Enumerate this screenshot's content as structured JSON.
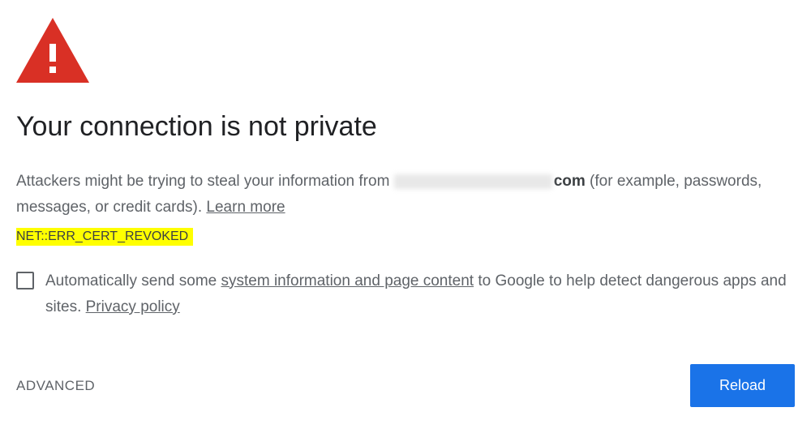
{
  "title": "Your connection is not private",
  "body": {
    "prefix": "Attackers might be trying to steal your information from ",
    "domain_suffix": "com",
    "suffix": " (for example, passwords, messages, or credit cards). ",
    "learn_more": "Learn more"
  },
  "error_code": "NET::ERR_CERT_REVOKED",
  "checkbox": {
    "prefix": "Automatically send some ",
    "link1": "system information and page content",
    "mid": " to Google to help detect dangerous apps and sites. ",
    "link2": "Privacy policy"
  },
  "buttons": {
    "advanced": "ADVANCED",
    "reload": "Reload"
  },
  "colors": {
    "warning_red": "#d93025",
    "primary_blue": "#1a73e8",
    "highlight_yellow": "#ffff00"
  }
}
